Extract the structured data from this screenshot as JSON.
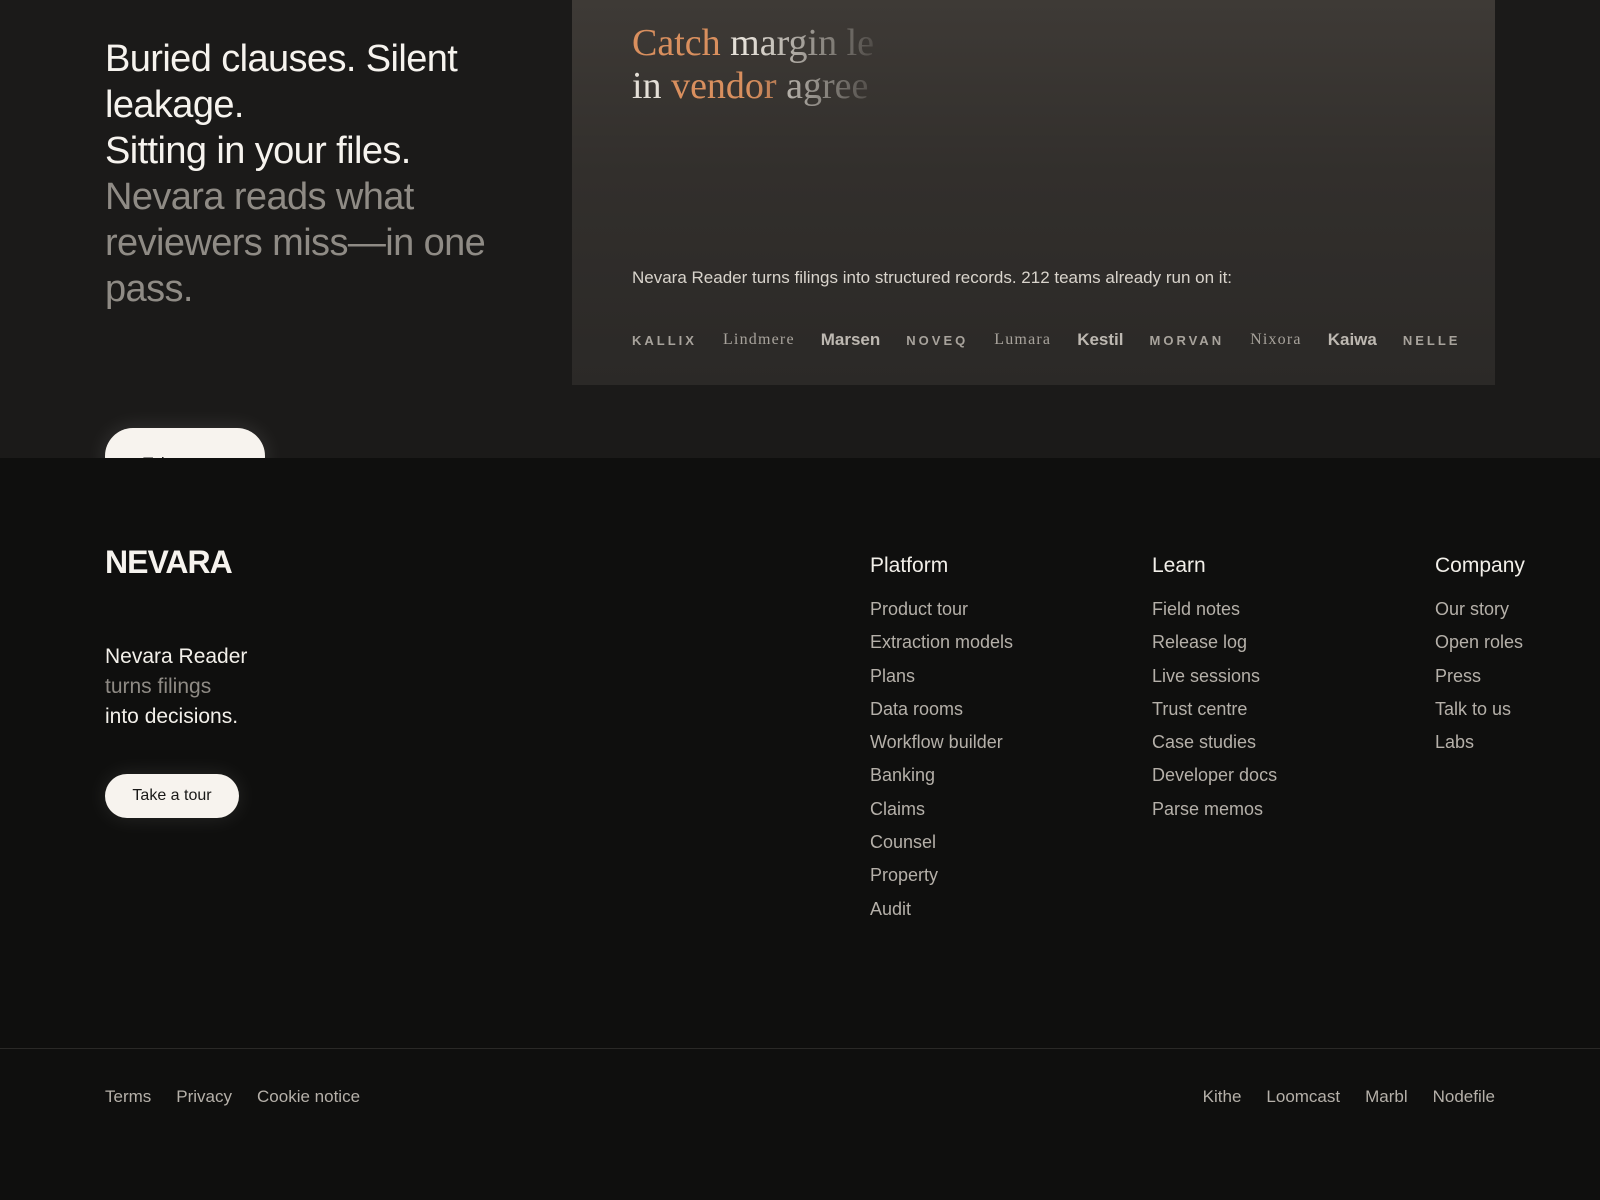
{
  "hero": {
    "heading_lines": [
      "Buried clauses. Silent",
      "leakage.",
      "Sitting in your files."
    ],
    "subheading_lines": [
      "Nevara reads what",
      "reviewers miss—in one",
      "pass."
    ],
    "tour_label": "Take a tour"
  },
  "panel": {
    "headline_row1": {
      "accent": "Catch",
      "plain": "margin le"
    },
    "headline_row2": {
      "plain": "in",
      "accent": "vendor",
      "rest": "agree"
    },
    "caption": "Nevara Reader turns filings into structured records. 212 teams already run on it:",
    "logos": [
      "KALLIX",
      "Lindmere",
      "Marsen",
      "NOVEQ",
      "Lumara",
      "Kestil",
      "MORVAN",
      "Nixora",
      "Kaiwa",
      "NELLE"
    ]
  },
  "footer": {
    "brand": "NEVARA",
    "tagline": [
      "Nevara Reader",
      "turns filings",
      "into decisions."
    ],
    "tour_label": "Take a tour",
    "columns": [
      {
        "title": "Platform",
        "links": [
          "Product tour",
          "Extraction models",
          "Plans",
          "Data rooms",
          "Workflow builder",
          "Banking",
          "Claims",
          "Counsel",
          "Property",
          "Audit"
        ]
      },
      {
        "title": "Learn",
        "links": [
          "Field notes",
          "Release log",
          "Live sessions",
          "Trust centre",
          "Case studies",
          "Developer docs",
          "Parse memos"
        ]
      },
      {
        "title": "Company",
        "links": [
          "Our story",
          "Open roles",
          "Press",
          "Talk to us",
          "Labs"
        ]
      }
    ],
    "legal": [
      "Terms",
      "Privacy",
      "Cookie notice"
    ],
    "sister_sites": [
      "Kithe",
      "Loomcast",
      "Marbl",
      "Nodefile"
    ]
  },
  "colors": {
    "accent": "#d98f5e",
    "hero_bg": "#1b1a19",
    "footer_bg": "#0f0f0e",
    "button_bg": "#f7f3ee"
  }
}
